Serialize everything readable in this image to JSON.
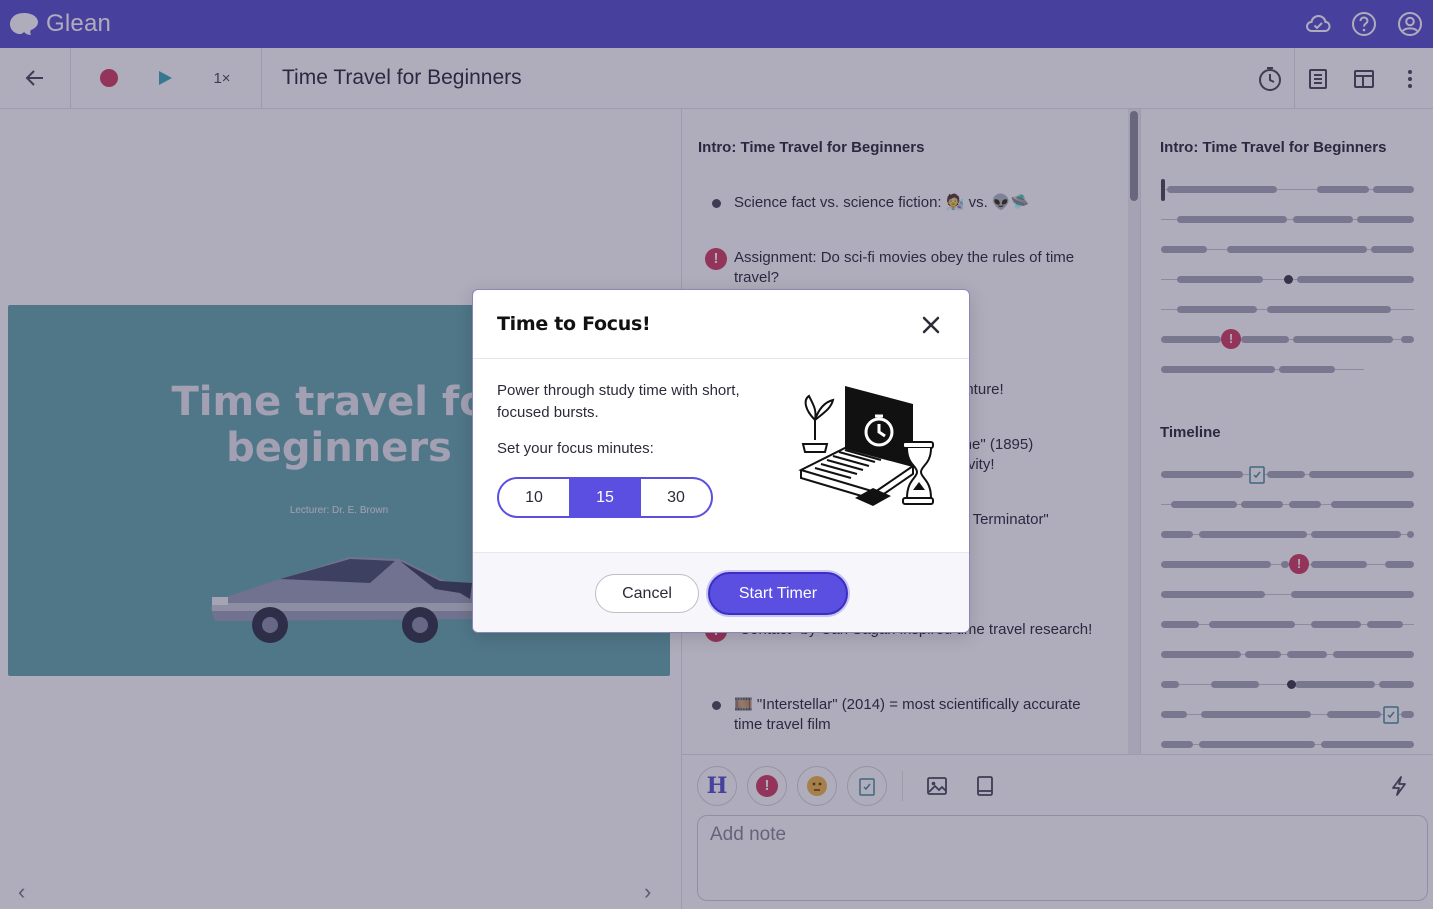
{
  "app": {
    "brand": "Glean"
  },
  "appbar": {
    "icons": [
      "cloud-check-icon",
      "help-icon",
      "account-icon"
    ]
  },
  "toolbar": {
    "title": "Time Travel for Beginners",
    "speed_label": "1×",
    "icons": [
      "back-arrow-icon",
      "record-icon",
      "play-icon",
      "focus-timer-icon",
      "notes-view-icon",
      "layout-icon",
      "more-vertical-icon"
    ]
  },
  "slide": {
    "title_line1": "Time travel for",
    "title_line2": "beginners",
    "lecturer": "Lecturer: Dr. E. Brown"
  },
  "notes": {
    "heading": "Intro: Time Travel for Beginners",
    "items": [
      {
        "type": "bullet",
        "text": "Science fact vs. science fiction: 🧑‍🔬 vs. 👽🛸"
      },
      {
        "type": "important",
        "text": "Assignment: Do sci-fi movies obey the rules of time travel?"
      },
      {
        "type": "bullet",
        "text": "renture!"
      },
      {
        "type": "bullet",
        "text": "hine\" (1895)"
      },
      {
        "type": "bullet",
        "text": "ativity!"
      },
      {
        "type": "bullet",
        "text": "he Terminator\""
      },
      {
        "type": "important",
        "text": "\"Contact\" by Carl Sagan inspired time travel research!"
      },
      {
        "type": "bullet",
        "text": "🎞️ \"Interstellar\" (2014) = most scientifically accurate time travel film"
      }
    ]
  },
  "outline": {
    "heading1": "Intro: Time Travel for Beginners",
    "heading2": "Timeline"
  },
  "input": {
    "placeholder": "Add note",
    "tag_heading": "H",
    "tag_important": "!"
  },
  "modal": {
    "title": "Time to Focus!",
    "description": "Power through study time with short, focused bursts.",
    "minutes_label": "Set your focus minutes:",
    "options": [
      "10",
      "15",
      "30"
    ],
    "selected": "15",
    "cancel_label": "Cancel",
    "start_label": "Start Timer"
  },
  "colors": {
    "brand": "#5a4fcf",
    "accent": "#5a4fe0",
    "important": "#d23c63",
    "slide_bg": "#66a8ad"
  }
}
